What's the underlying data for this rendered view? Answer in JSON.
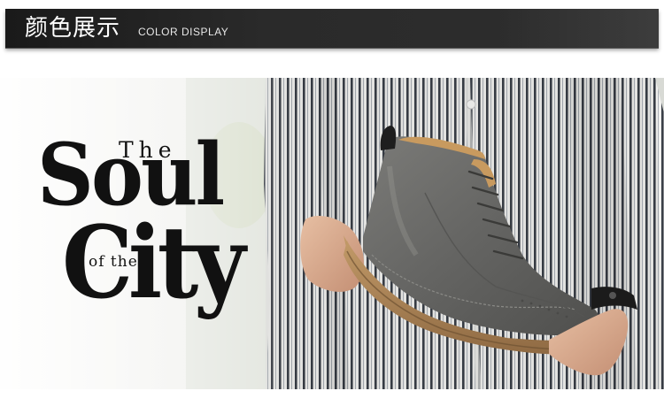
{
  "header": {
    "title_cn": "颜色展示",
    "title_en": "COLOR DISPLAY"
  },
  "banner": {
    "slogan": {
      "the": "The",
      "soul": "Soul",
      "of_the": "of the",
      "city": "City"
    },
    "product_image": "grey leather high-top lace-up boot held in hands",
    "colors": {
      "boot_leather": "#6d6d6b",
      "sole": "#b08a5e",
      "shirt_stripe": "#3a3f48"
    }
  }
}
